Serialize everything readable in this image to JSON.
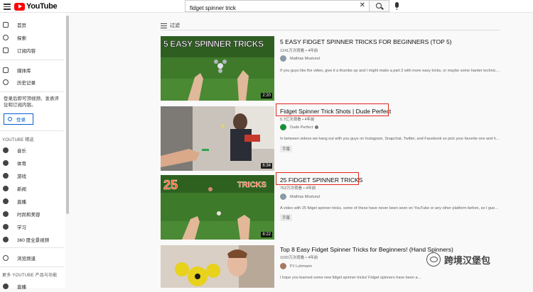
{
  "header": {
    "logo_text": "YouTube",
    "search_value": "fidget spinner trick",
    "clear_glyph": "✕"
  },
  "sidebar": {
    "primary": [
      {
        "label": "首页",
        "icon": "home-icon"
      },
      {
        "label": "探索",
        "icon": "compass-icon"
      },
      {
        "label": "订阅内容",
        "icon": "subscriptions-icon"
      }
    ],
    "library": [
      {
        "label": "媒体库",
        "icon": "library-icon"
      },
      {
        "label": "历史记录",
        "icon": "history-icon"
      }
    ],
    "signin_text": "登录后即可顶视频、发表评论和订阅内容。",
    "login_label": "登录",
    "best_title": "YOUTUBE 精选",
    "best": [
      {
        "label": "音乐",
        "icon": "music-icon"
      },
      {
        "label": "体育",
        "icon": "sports-icon"
      },
      {
        "label": "游戏",
        "icon": "gaming-icon"
      },
      {
        "label": "新闻",
        "icon": "news-icon"
      },
      {
        "label": "直播",
        "icon": "live-icon"
      },
      {
        "label": "时尚和美容",
        "icon": "fashion-icon"
      },
      {
        "label": "学习",
        "icon": "learning-icon"
      },
      {
        "label": "360 度全景视频",
        "icon": "360-icon"
      }
    ],
    "browse_label": "浏览频道",
    "more_title": "更多 YOUTUBE 产品与功能",
    "bottom_item": "直播"
  },
  "filter_label": "过滤",
  "videos": [
    {
      "thumb_text": "5 EASY SPINNER TRICKS",
      "duration": "2:20",
      "title": "5 EASY FIDGET SPINNER TRICKS FOR BEGINNERS (TOP 5)",
      "meta": "1241万次观看 • 4年前",
      "channel": "Mathias Mostund",
      "desc": "If you guys like the video, give it a thumbs up and I might make a part 2 with more easy tricks, or maybe some harder technical ..."
    },
    {
      "duration": "6:34",
      "title": "Fidget Spinner Trick Shots | Dude Perfect",
      "meta": "5.7亿次观看 • 4年前",
      "channel": "Dude Perfect",
      "desc": "In between videos we hang out with you guys on Instagram, Snapchat, Twitter, and Facebook so pick your favorite one and hang ...",
      "badge": "字幕"
    },
    {
      "thumb_text_1": "25",
      "thumb_text_2": "TRICKS",
      "duration": "8:22",
      "title": "25 FIDGET SPINNER TRICKS",
      "meta": "762万次观看 • 4年前",
      "channel": "Mathias Mostund",
      "desc": "A video with 25 fidget spinner tricks, some of these have never been seen on YouTube or any other platform before, so I guess I ...",
      "badge": "字幕"
    },
    {
      "title": "Top 8 Easy Fidget Spinner Tricks for Beginners! (Hand Spinners)",
      "meta": "1020万次观看 • 4年前",
      "channel": "PJ Luhmann",
      "desc": "I hope you learned some new fidget spinner tricks! Fidget spinners have been a fun hand for awhile now. So I thought I would ..."
    }
  ],
  "watermark": "跨境汉堡包"
}
